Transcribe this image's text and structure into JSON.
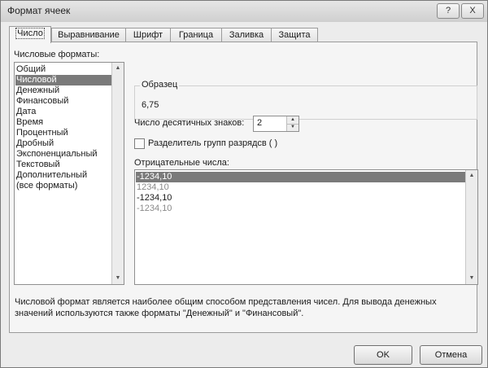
{
  "window": {
    "title": "Формат ячеек",
    "help_label": "?",
    "close_label": "X"
  },
  "tabs": [
    {
      "label": "Число"
    },
    {
      "label": "Выравнивание"
    },
    {
      "label": "Шрифт"
    },
    {
      "label": "Граница"
    },
    {
      "label": "Заливка"
    },
    {
      "label": "Защита"
    }
  ],
  "formats": {
    "label": "Числовые форматы:",
    "items": [
      "Общий",
      "Числовой",
      "Денежный",
      "Финансовый",
      "Дата",
      "Время",
      "Процентный",
      "Дробный",
      "Экспоненциальный",
      "Текстовый",
      "Дополнительный",
      "(все форматы)"
    ],
    "selected": "Числовой"
  },
  "sample": {
    "legend": "Образец",
    "value": "6,75"
  },
  "decimals": {
    "label": "Число десятичных знаков:",
    "value": "2"
  },
  "separator": {
    "label": "Разделитель групп разрядсв ( )",
    "checked": false
  },
  "negative": {
    "label": "Отрицательные числа:",
    "items": [
      "-1234,10",
      "1234,10",
      "-1234,10",
      "-1234,10"
    ],
    "selected": "-1234,10",
    "colors": {
      "normal": "#000000",
      "red_shown_gray": "#8a8a8a"
    }
  },
  "description": "Числовой формат является наиболее общим способом представления чисел. Для вывода денежных значений используются также форматы \"Денежный\" и \"Финансовый\".",
  "buttons": {
    "ok": "OK",
    "cancel": "Отмена"
  }
}
